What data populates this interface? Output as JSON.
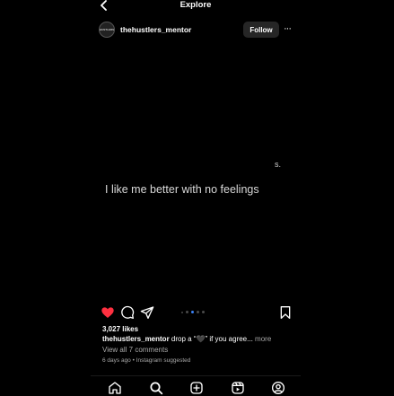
{
  "header": {
    "title": "Explore"
  },
  "post": {
    "username": "thehustlers_mentor",
    "avatar_label": "HUSTLERS",
    "follow_label": "Follow",
    "more_glyph": "···",
    "media": {
      "corner_mark": "s.",
      "quote": "I like me better with no feelings"
    },
    "likes": "3,027 likes",
    "caption": {
      "user": "thehustlers_mentor",
      "text": " drop a “🖤” if you agree...",
      "more": " more"
    },
    "view_comments": "View all 7 comments",
    "meta": "6 days ago • Instagram suggested",
    "carousel": {
      "count": 5,
      "active_index": 2
    }
  },
  "colors": {
    "background": "#000000",
    "like_red": "#ff3040",
    "carousel_active": "#3b82f6",
    "follow_bg": "#262626",
    "secondary_text": "#a8a8a8"
  },
  "icons": {
    "actions": [
      "heart-icon",
      "comment-icon",
      "share-icon",
      "bookmark-icon"
    ],
    "nav": [
      "home-icon",
      "search-icon",
      "create-icon",
      "reels-icon",
      "profile-icon"
    ]
  }
}
